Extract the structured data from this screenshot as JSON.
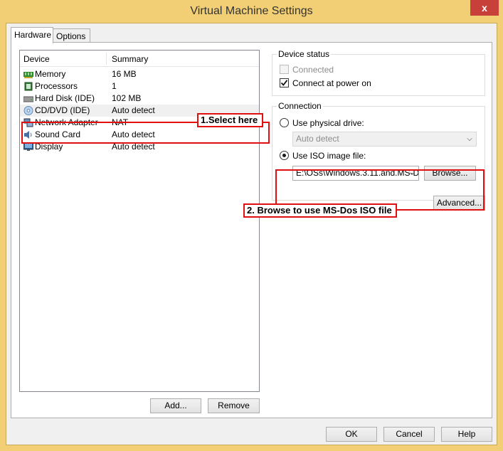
{
  "window": {
    "title": "Virtual Machine Settings",
    "close_glyph": "x"
  },
  "tabs": [
    {
      "label": "Hardware"
    },
    {
      "label": "Options"
    }
  ],
  "device_list": {
    "columns": {
      "device": "Device",
      "summary": "Summary"
    },
    "rows": [
      {
        "device": "Memory",
        "summary": "16 MB",
        "icon": "memory-icon"
      },
      {
        "device": "Processors",
        "summary": "1",
        "icon": "processor-icon"
      },
      {
        "device": "Hard Disk (IDE)",
        "summary": "102 MB",
        "icon": "hard-disk-icon"
      },
      {
        "device": "CD/DVD (IDE)",
        "summary": "Auto detect",
        "icon": "cd-dvd-icon",
        "selected": true
      },
      {
        "device": "Network Adapter",
        "summary": "NAT",
        "icon": "network-adapter-icon"
      },
      {
        "device": "Sound Card",
        "summary": "Auto detect",
        "icon": "sound-card-icon"
      },
      {
        "device": "Display",
        "summary": "Auto detect",
        "icon": "display-icon"
      }
    ]
  },
  "list_buttons": {
    "add": "Add...",
    "remove": "Remove"
  },
  "device_status": {
    "legend": "Device status",
    "connected": {
      "label": "Connected",
      "checked": false,
      "disabled": true
    },
    "connect_at_power_on": {
      "label": "Connect at power on",
      "checked": true
    }
  },
  "connection": {
    "legend": "Connection",
    "physical_drive": {
      "label": "Use physical drive:",
      "selected": false,
      "value": "Auto detect"
    },
    "iso_image": {
      "label": "Use ISO image file:",
      "selected": true,
      "value": "E:\\OSs\\Windows.3.11.and.MS-D"
    },
    "browse_label": "Browse...",
    "advanced_label": "Advanced..."
  },
  "annotations": {
    "step1": "1.Select here",
    "step2": "2. Browse to use MS-Dos ISO file",
    "color": "#e01010"
  },
  "dialog_buttons": {
    "ok": "OK",
    "cancel": "Cancel",
    "help": "Help"
  },
  "colors": {
    "frame": "#f2cf74",
    "close": "#c7403a",
    "panel": "#f0f0f0"
  }
}
